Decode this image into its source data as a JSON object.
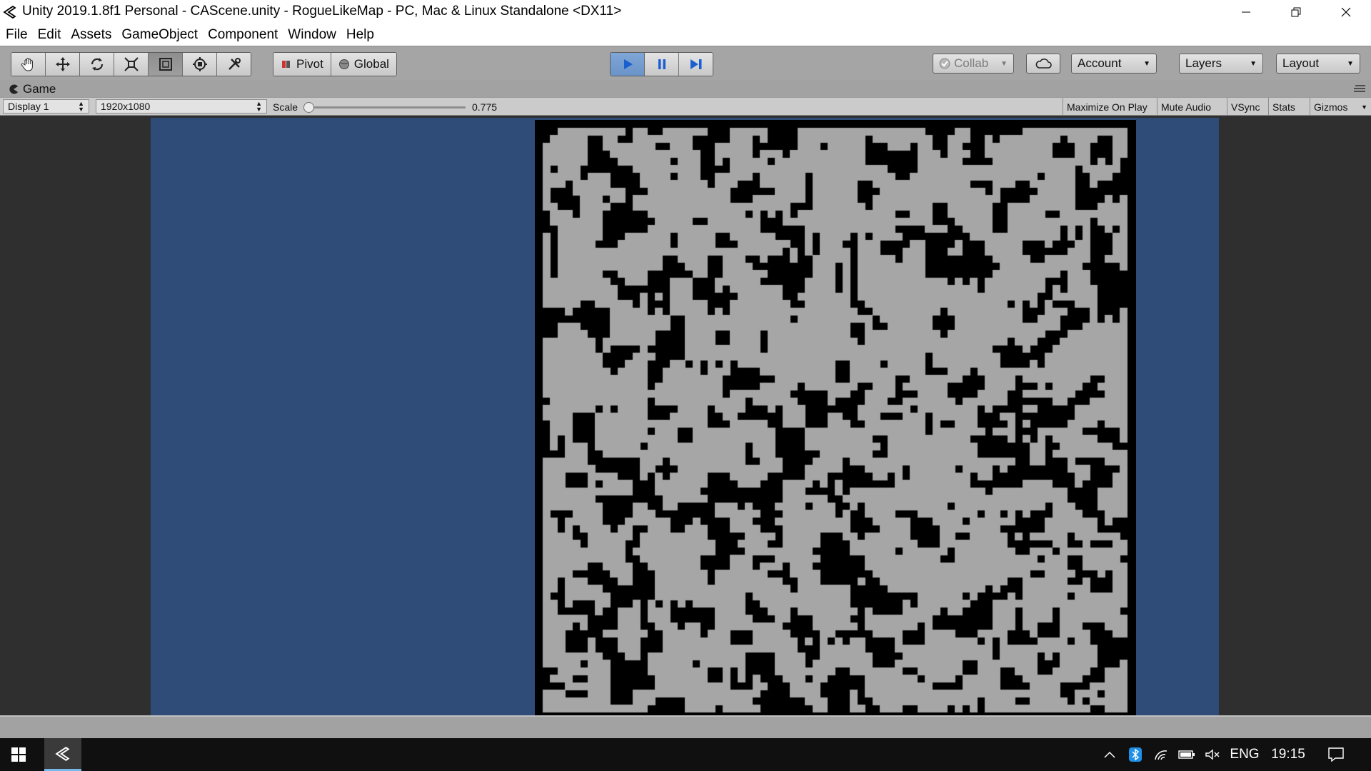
{
  "window": {
    "title": "Unity 2019.1.8f1 Personal - CAScene.unity - RogueLikeMap - PC, Mac & Linux Standalone <DX11>",
    "controls": [
      "minimize-icon",
      "restore-icon",
      "close-icon"
    ]
  },
  "menu": {
    "items": [
      "File",
      "Edit",
      "Assets",
      "GameObject",
      "Component",
      "Window",
      "Help"
    ]
  },
  "toolbar": {
    "tools": [
      "hand-icon",
      "move-icon",
      "rotate-icon",
      "scale-icon",
      "rect-tool-icon",
      "transform-tool-icon",
      "custom-tool-icon"
    ],
    "active_tool": "rect-tool-icon",
    "pivot_label": "Pivot",
    "global_label": "Global",
    "play_state": "playing",
    "collab_label": "Collab",
    "account_label": "Account",
    "layers_label": "Layers",
    "layout_label": "Layout"
  },
  "game_tab": {
    "label": "Game",
    "display": "Display 1",
    "resolution": "1920x1080",
    "scale_label": "Scale",
    "scale_value": "0.775",
    "toggles": [
      "Maximize On Play",
      "Mute Audio",
      "VSync",
      "Stats",
      "Gizmos"
    ]
  },
  "game_view": {
    "camera_background": "#2f4c79",
    "map_wall_color": "#000000",
    "map_floor_color": "#a6a6a6"
  },
  "taskbar": {
    "language": "ENG",
    "time": "19:15",
    "icons": [
      "windows-start-icon",
      "unity-taskbar-icon",
      "chevron-up-icon",
      "bluetooth-icon",
      "wifi-icon",
      "battery-icon",
      "volume-muted-icon",
      "notification-icon"
    ]
  },
  "colors": {
    "toolbar_bg": "#a5a5a5",
    "play_active": "#6a93c8",
    "taskbar_bg": "#101010"
  }
}
